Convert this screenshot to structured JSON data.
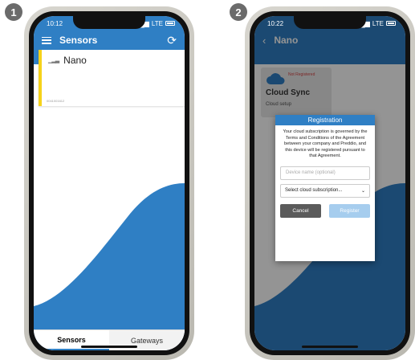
{
  "steps": [
    "1",
    "2"
  ],
  "phone1": {
    "time": "10:12",
    "signal": "LTE",
    "title": "Sensors",
    "card": {
      "name": "Nano",
      "id": "0041001612"
    },
    "tabs": [
      "Sensors",
      "Gateways"
    ]
  },
  "phone2": {
    "time": "10:22",
    "signal": "LTE",
    "title": "Nano",
    "cloud_card": {
      "status": "Not Registered",
      "title": "Cloud Sync",
      "subtitle": "Cloud setup"
    },
    "dialog": {
      "title": "Registration",
      "body": "Your cloud subscription is governed by the Terms and Conditions of the Agreement between your company and Preddio, and this device will be registered pursuant to that Agreement.",
      "device_placeholder": "Device name (optional)",
      "subscription_select": "Select cloud subscription...",
      "cancel_label": "Cancel",
      "register_label": "Register"
    }
  },
  "colors": {
    "accent": "#2f7fc4",
    "card_stripe": "#f6d21a",
    "status_red": "#d64545"
  }
}
